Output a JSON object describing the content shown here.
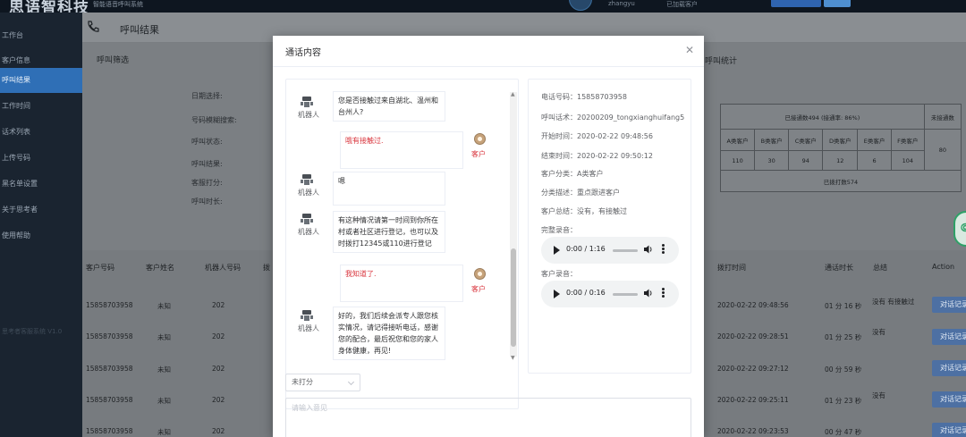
{
  "topbar": {
    "logo": "思语智科技",
    "logo_sub": "智能语音呼叫系统",
    "user": "zhangyu",
    "status": "已加载客户"
  },
  "sidebar": {
    "items": [
      {
        "label": "工作台"
      },
      {
        "label": "客户信息"
      },
      {
        "label": "呼叫结果"
      },
      {
        "label": "工作时间"
      },
      {
        "label": "话术列表"
      },
      {
        "label": "上传号码"
      },
      {
        "label": "黑名单设置"
      },
      {
        "label": "关于思考者"
      },
      {
        "label": "使用帮助"
      }
    ],
    "active_index": 2,
    "footer": "思考者客服系统 V1.0"
  },
  "page": {
    "title": "呼叫结果",
    "filter_title": "呼叫筛选",
    "stats_title": "呼叫统计",
    "filter_labels": [
      "日期选择:",
      "号码模糊搜索:",
      "呼叫状态:",
      "呼叫结果:",
      "客服打分:",
      "呼叫时长:"
    ]
  },
  "stats": {
    "connected": "已接通数494 (接通率: 86%)",
    "not_connected_label": "未接通数",
    "not_connected_value": "80",
    "classes": [
      "A类客户",
      "B类客户",
      "C类客户",
      "D类客户",
      "E类客户",
      "F类客户"
    ],
    "class_values": [
      "110",
      "30",
      "94",
      "12",
      "6",
      "104"
    ],
    "dialed": "已拨打数574"
  },
  "table": {
    "headers": [
      "客户号码",
      "客户姓名",
      "机器人号码",
      "拨",
      "拨打时间",
      "通话时长",
      "总结",
      "Action"
    ],
    "rows": [
      {
        "phone": "15858703958",
        "name": "未知",
        "robot": "202",
        "time": "2020-02-22 09:48:56",
        "duration": "01 分 16 秒",
        "summary": "没有  有接触过",
        "action": "对话记录"
      },
      {
        "phone": "15858703958",
        "name": "未知",
        "robot": "202",
        "time": "2020-02-22 09:28:51",
        "duration": "01 分 25 秒",
        "summary": "没有",
        "action": "对话记录"
      },
      {
        "phone": "15858703958",
        "name": "未知",
        "robot": "202",
        "time": "2020-02-22 09:27:12",
        "duration": "00 分 59 秒",
        "summary": "",
        "action": "对话记录"
      },
      {
        "phone": "15858703958",
        "name": "未知",
        "robot": "202",
        "time": "2020-02-22 09:25:11",
        "duration": "01 分 23 秒",
        "summary": "没有",
        "action": "对话记录"
      },
      {
        "phone": "15858703958",
        "name": "未知",
        "robot": "202",
        "time": "2020-02-22 09:23:53",
        "duration": "00 分 47 秒",
        "summary": "",
        "action": "对话记录"
      }
    ]
  },
  "modal": {
    "title": "通话内容",
    "robot_label": "机器人",
    "customer_label": "客户",
    "messages": [
      {
        "speaker": "robot",
        "text": "您是否接触过来自湖北、温州和台州人?"
      },
      {
        "speaker": "customer",
        "text": "哦有接触过."
      },
      {
        "speaker": "robot",
        "text": "嗯"
      },
      {
        "speaker": "robot",
        "text": "有这种情况请第一时间到你所在村或者社区进行登记，也可以及时拨打12345或110进行登记"
      },
      {
        "speaker": "customer",
        "text": "我知道了."
      },
      {
        "speaker": "robot",
        "text": "好的，我们后续会派专人跟您核实情况，请记得接听电话，感谢您的配合，最后祝您和您的家人身体健康，再见!"
      }
    ],
    "info": {
      "phone": "电话号码：15858703958",
      "script": "呼叫话术：20200209_tongxianghuifang5",
      "start": "开始时间：2020-02-22 09:48:56",
      "end": "结束时间：2020-02-22 09:50:12",
      "category": "客户分类：A类客户",
      "description": "分类描述：重点跟进客户",
      "summary": "客户总结：没有，有接触过",
      "full_audio_label": "完整录音：",
      "full_audio_time": "0:00 / 1:16",
      "customer_audio_label": "客户录音：",
      "customer_audio_time": "0:00 / 0:16"
    },
    "rating_value": "未打分",
    "comment_placeholder": "请输入意见"
  }
}
